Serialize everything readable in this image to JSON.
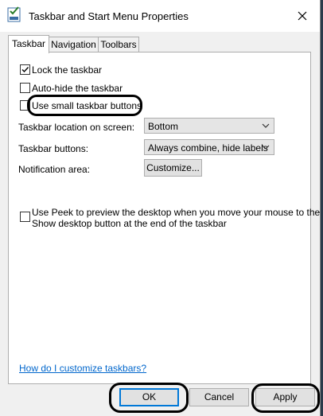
{
  "window": {
    "title": "Taskbar and Start Menu Properties",
    "icon": "taskbar-properties-icon",
    "close_icon": "close-icon"
  },
  "tabs": [
    {
      "label": "Taskbar",
      "selected": true
    },
    {
      "label": "Navigation",
      "selected": false
    },
    {
      "label": "Toolbars",
      "selected": false
    }
  ],
  "taskbar_tab": {
    "lock_taskbar": {
      "label": "Lock the taskbar",
      "checked": true
    },
    "auto_hide": {
      "label": "Auto-hide the taskbar",
      "checked": false
    },
    "small_buttons": {
      "label": "Use small taskbar buttons",
      "checked": false
    },
    "location": {
      "label": "Taskbar location on screen:",
      "value": "Bottom"
    },
    "buttons": {
      "label": "Taskbar buttons:",
      "value": "Always combine, hide labels"
    },
    "notification": {
      "label": "Notification area:",
      "button": "Customize..."
    },
    "peek": {
      "line1": "Use Peek to preview the desktop when you move your mouse to the",
      "line2": "Show desktop button at the end of the taskbar",
      "checked": false
    },
    "help_link": "How do I customize taskbars?"
  },
  "footer": {
    "ok": "OK",
    "cancel": "Cancel",
    "apply": "Apply"
  },
  "colors": {
    "accent": "#0078d7",
    "link": "#0066cc",
    "dialog_bg": "#f0f0f0"
  }
}
